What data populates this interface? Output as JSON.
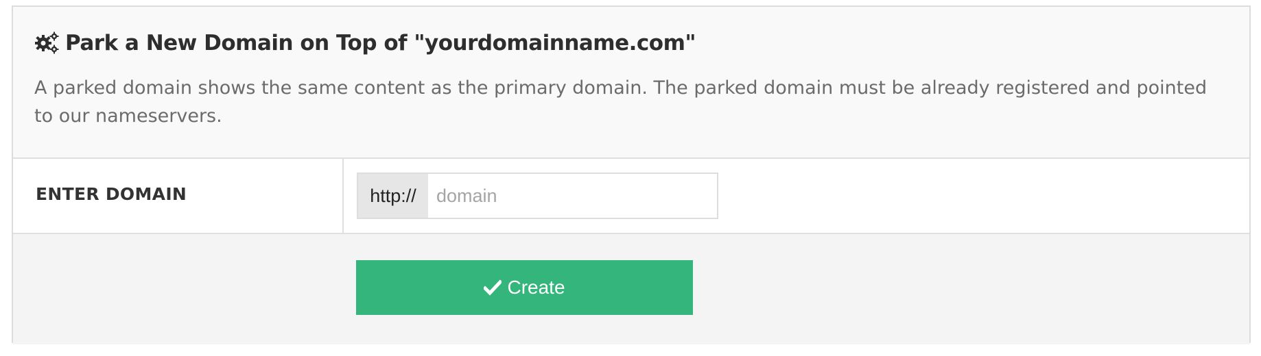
{
  "panel": {
    "icon": "gears-icon",
    "title": "Park a New Domain on Top of \"yourdomainname.com\"",
    "description": "A parked domain shows the same content as the primary domain. The parked domain must be already registered and pointed to our nameservers."
  },
  "form": {
    "label": "ENTER DOMAIN",
    "prefix": "http://",
    "domain_value": "",
    "domain_placeholder": "domain"
  },
  "actions": {
    "create_icon": "check-icon",
    "create_label": "Create"
  },
  "colors": {
    "accent": "#33b57b",
    "header_bg": "#f9f9f9",
    "footer_bg": "#f4f4f4"
  }
}
